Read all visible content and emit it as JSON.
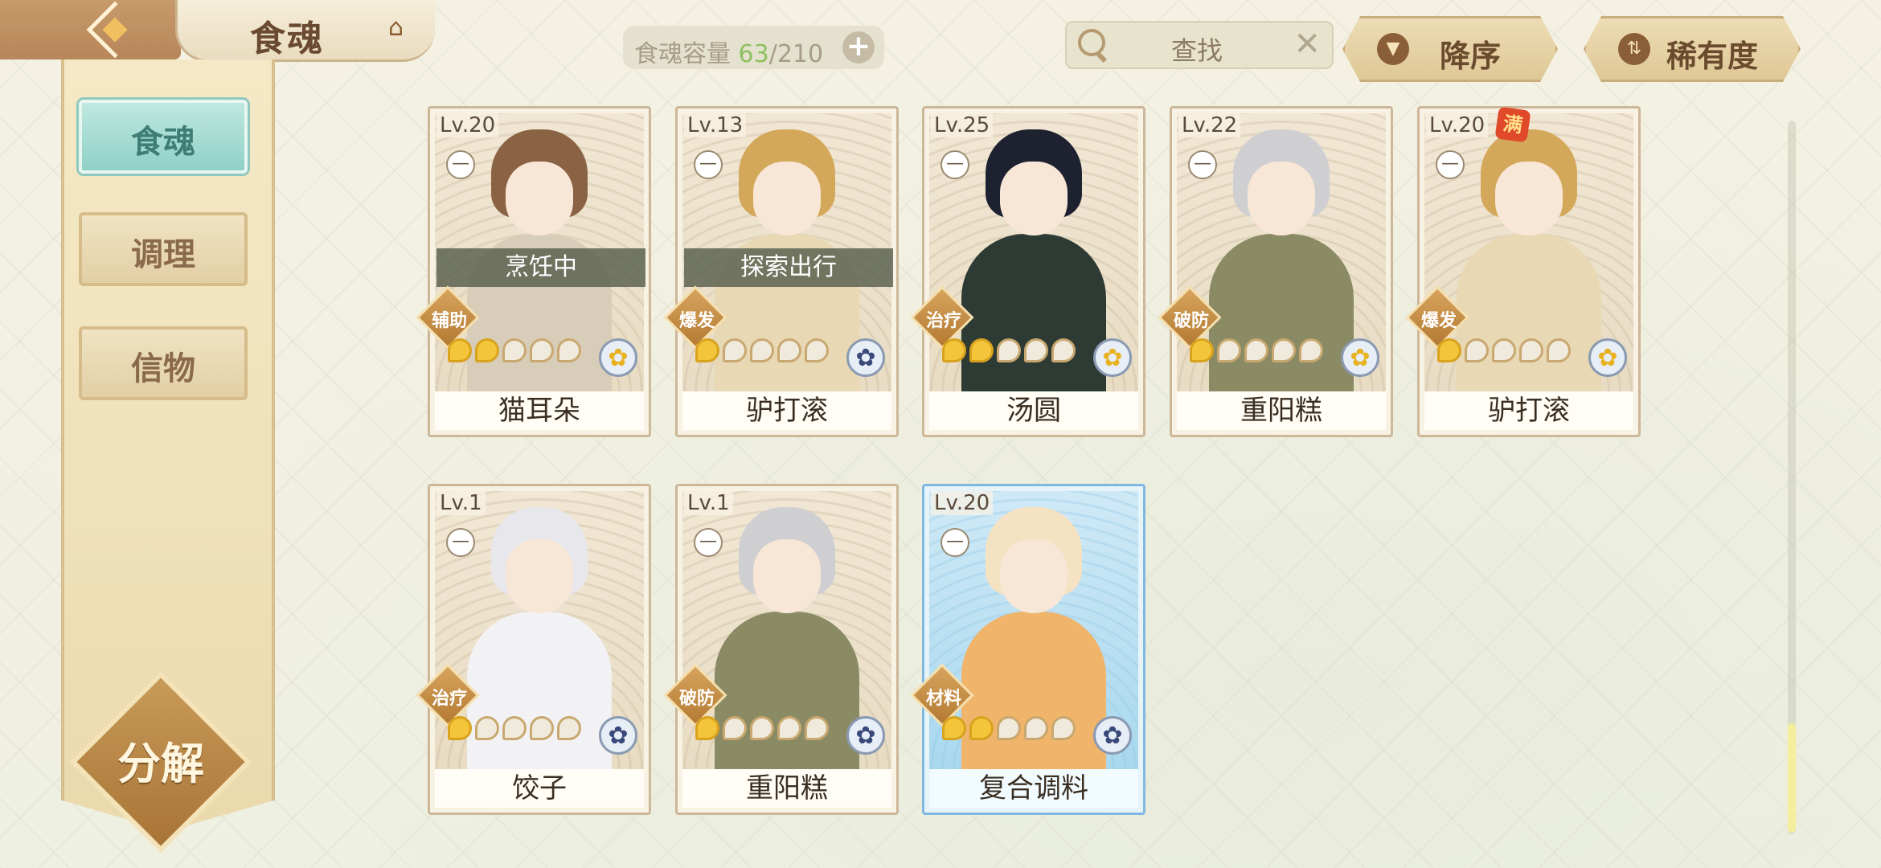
{
  "header": {
    "title": "食魂",
    "capacity_label": "食魂容量",
    "capacity_current": "63",
    "capacity_total": "/210",
    "search_placeholder": "查找",
    "sort_order_label": "降序",
    "sort_key_label": "稀有度"
  },
  "sidebar": {
    "items": [
      {
        "label": "食魂",
        "active": true
      },
      {
        "label": "调理",
        "active": false
      },
      {
        "label": "信物",
        "active": false
      }
    ],
    "decompose_label": "分解"
  },
  "cards": [
    {
      "level": "Lv.20",
      "name": "猫耳朵",
      "role": "辅助",
      "status": "烹饪中",
      "stars": 2,
      "emblem": "gold",
      "theme": "normal"
    },
    {
      "level": "Lv.13",
      "name": "驴打滚",
      "role": "爆发",
      "status": "探索出行",
      "stars": 1,
      "emblem": "navy",
      "theme": "normal"
    },
    {
      "level": "Lv.25",
      "name": "汤圆",
      "role": "治疗",
      "status": "",
      "stars": 2,
      "emblem": "gold",
      "theme": "normal"
    },
    {
      "level": "Lv.22",
      "name": "重阳糕",
      "role": "破防",
      "status": "",
      "stars": 1,
      "emblem": "gold",
      "theme": "normal"
    },
    {
      "level": "Lv.20",
      "name": "驴打滚",
      "role": "爆发",
      "status": "",
      "stars": 1,
      "emblem": "gold",
      "theme": "normal",
      "max_badge": "满"
    },
    {
      "level": "Lv.1",
      "name": "饺子",
      "role": "治疗",
      "status": "",
      "stars": 1,
      "emblem": "navy",
      "theme": "normal"
    },
    {
      "level": "Lv.1",
      "name": "重阳糕",
      "role": "破防",
      "status": "",
      "stars": 1,
      "emblem": "navy",
      "theme": "normal"
    },
    {
      "level": "Lv.20",
      "name": "复合调料",
      "role": "材料",
      "status": "",
      "stars": 2,
      "emblem": "navy",
      "theme": "blue"
    }
  ],
  "colors": {
    "accent_teal": "#8fd0c6",
    "gold": "#f2c53a",
    "brown": "#6b4b2d"
  }
}
